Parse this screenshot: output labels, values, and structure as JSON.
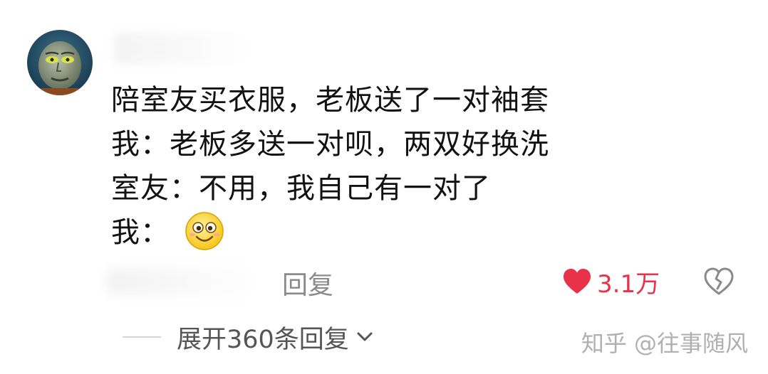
{
  "comment": {
    "lines": [
      "陪室友买衣服，老板送了一对袖套",
      "我：老板多送一对呗，两双好换洗",
      "室友：不用，我自己有一对了",
      "我："
    ],
    "emoji_icon": "grinning-face-icon"
  },
  "actions": {
    "reply_label": "回复",
    "like_count": "3.1万",
    "like_color": "#e8324a",
    "like_icon": "heart-icon",
    "dislike_icon": "broken-heart-icon"
  },
  "thread": {
    "expand_label": "展开360条回复",
    "expand_icon": "chevron-down-icon"
  },
  "watermark": {
    "text": "知乎 @往事随风"
  },
  "avatar": {
    "icon": "avatar-character-icon"
  }
}
